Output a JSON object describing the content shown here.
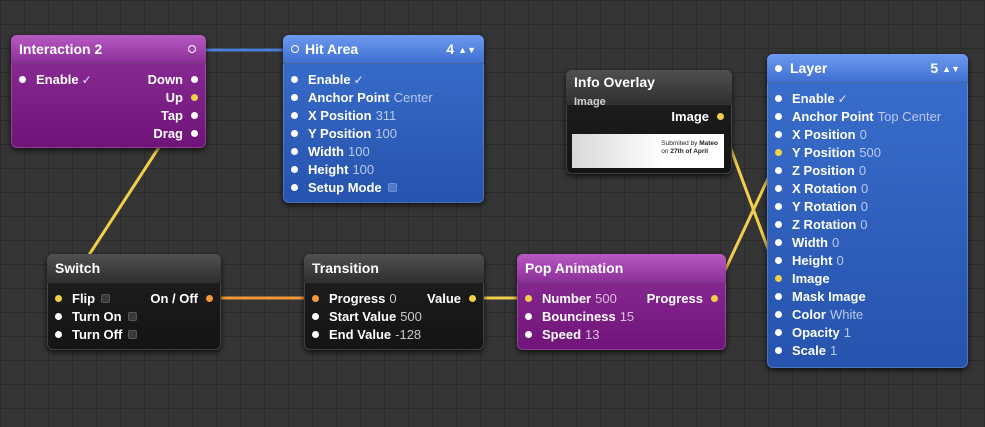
{
  "nodes": {
    "interaction": {
      "title": "Interaction 2",
      "inputs": [
        {
          "label": "Enable",
          "check": "✓"
        }
      ],
      "outputs": [
        "Down",
        "Up",
        "Tap",
        "Drag"
      ]
    },
    "hit_area": {
      "title": "Hit Area",
      "count": "4",
      "inputs": [
        {
          "label": "Enable",
          "check": "✓"
        },
        {
          "label": "Anchor Point",
          "value": "Center"
        },
        {
          "label": "X Position",
          "value": "311"
        },
        {
          "label": "Y Position",
          "value": "100"
        },
        {
          "label": "Width",
          "value": "100"
        },
        {
          "label": "Height",
          "value": "100"
        },
        {
          "label": "Setup Mode"
        }
      ]
    },
    "info_overlay": {
      "title": "Info Overlay",
      "subtitle": "Image",
      "output": "Image",
      "thumb_line1_a": "Submited by ",
      "thumb_line1_b": "Mateo",
      "thumb_line2_a": "on ",
      "thumb_line2_b": "27th of April"
    },
    "layer": {
      "title": "Layer",
      "count": "5",
      "inputs": [
        {
          "label": "Enable",
          "check": "✓"
        },
        {
          "label": "Anchor Point",
          "value": "Top Center"
        },
        {
          "label": "X Position",
          "value": "0"
        },
        {
          "label": "Y Position",
          "value": "500"
        },
        {
          "label": "Z Position",
          "value": "0"
        },
        {
          "label": "X Rotation",
          "value": "0"
        },
        {
          "label": "Y Rotation",
          "value": "0"
        },
        {
          "label": "Z Rotation",
          "value": "0"
        },
        {
          "label": "Width",
          "value": "0"
        },
        {
          "label": "Height",
          "value": "0"
        },
        {
          "label": "Image"
        },
        {
          "label": "Mask Image"
        },
        {
          "label": "Color",
          "value": "White"
        },
        {
          "label": "Opacity",
          "value": "1"
        },
        {
          "label": "Scale",
          "value": "1"
        }
      ]
    },
    "switch": {
      "title": "Switch",
      "inputs": [
        {
          "label": "Flip"
        },
        {
          "label": "Turn On"
        },
        {
          "label": "Turn Off"
        }
      ],
      "output": "On / Off"
    },
    "transition": {
      "title": "Transition",
      "inputs": [
        {
          "label": "Progress",
          "value": "0"
        },
        {
          "label": "Start Value",
          "value": "500"
        },
        {
          "label": "End Value",
          "value": "-128"
        }
      ],
      "output": "Value"
    },
    "pop": {
      "title": "Pop Animation",
      "inputs": [
        {
          "label": "Number",
          "value": "500"
        },
        {
          "label": "Bounciness",
          "value": "15"
        },
        {
          "label": "Speed",
          "value": "13"
        }
      ],
      "output": "Progress"
    }
  },
  "colors": {
    "wire_yellow": "#f2cf4a",
    "wire_orange": "#f5983a",
    "wire_blue": "#4a7fd6"
  }
}
